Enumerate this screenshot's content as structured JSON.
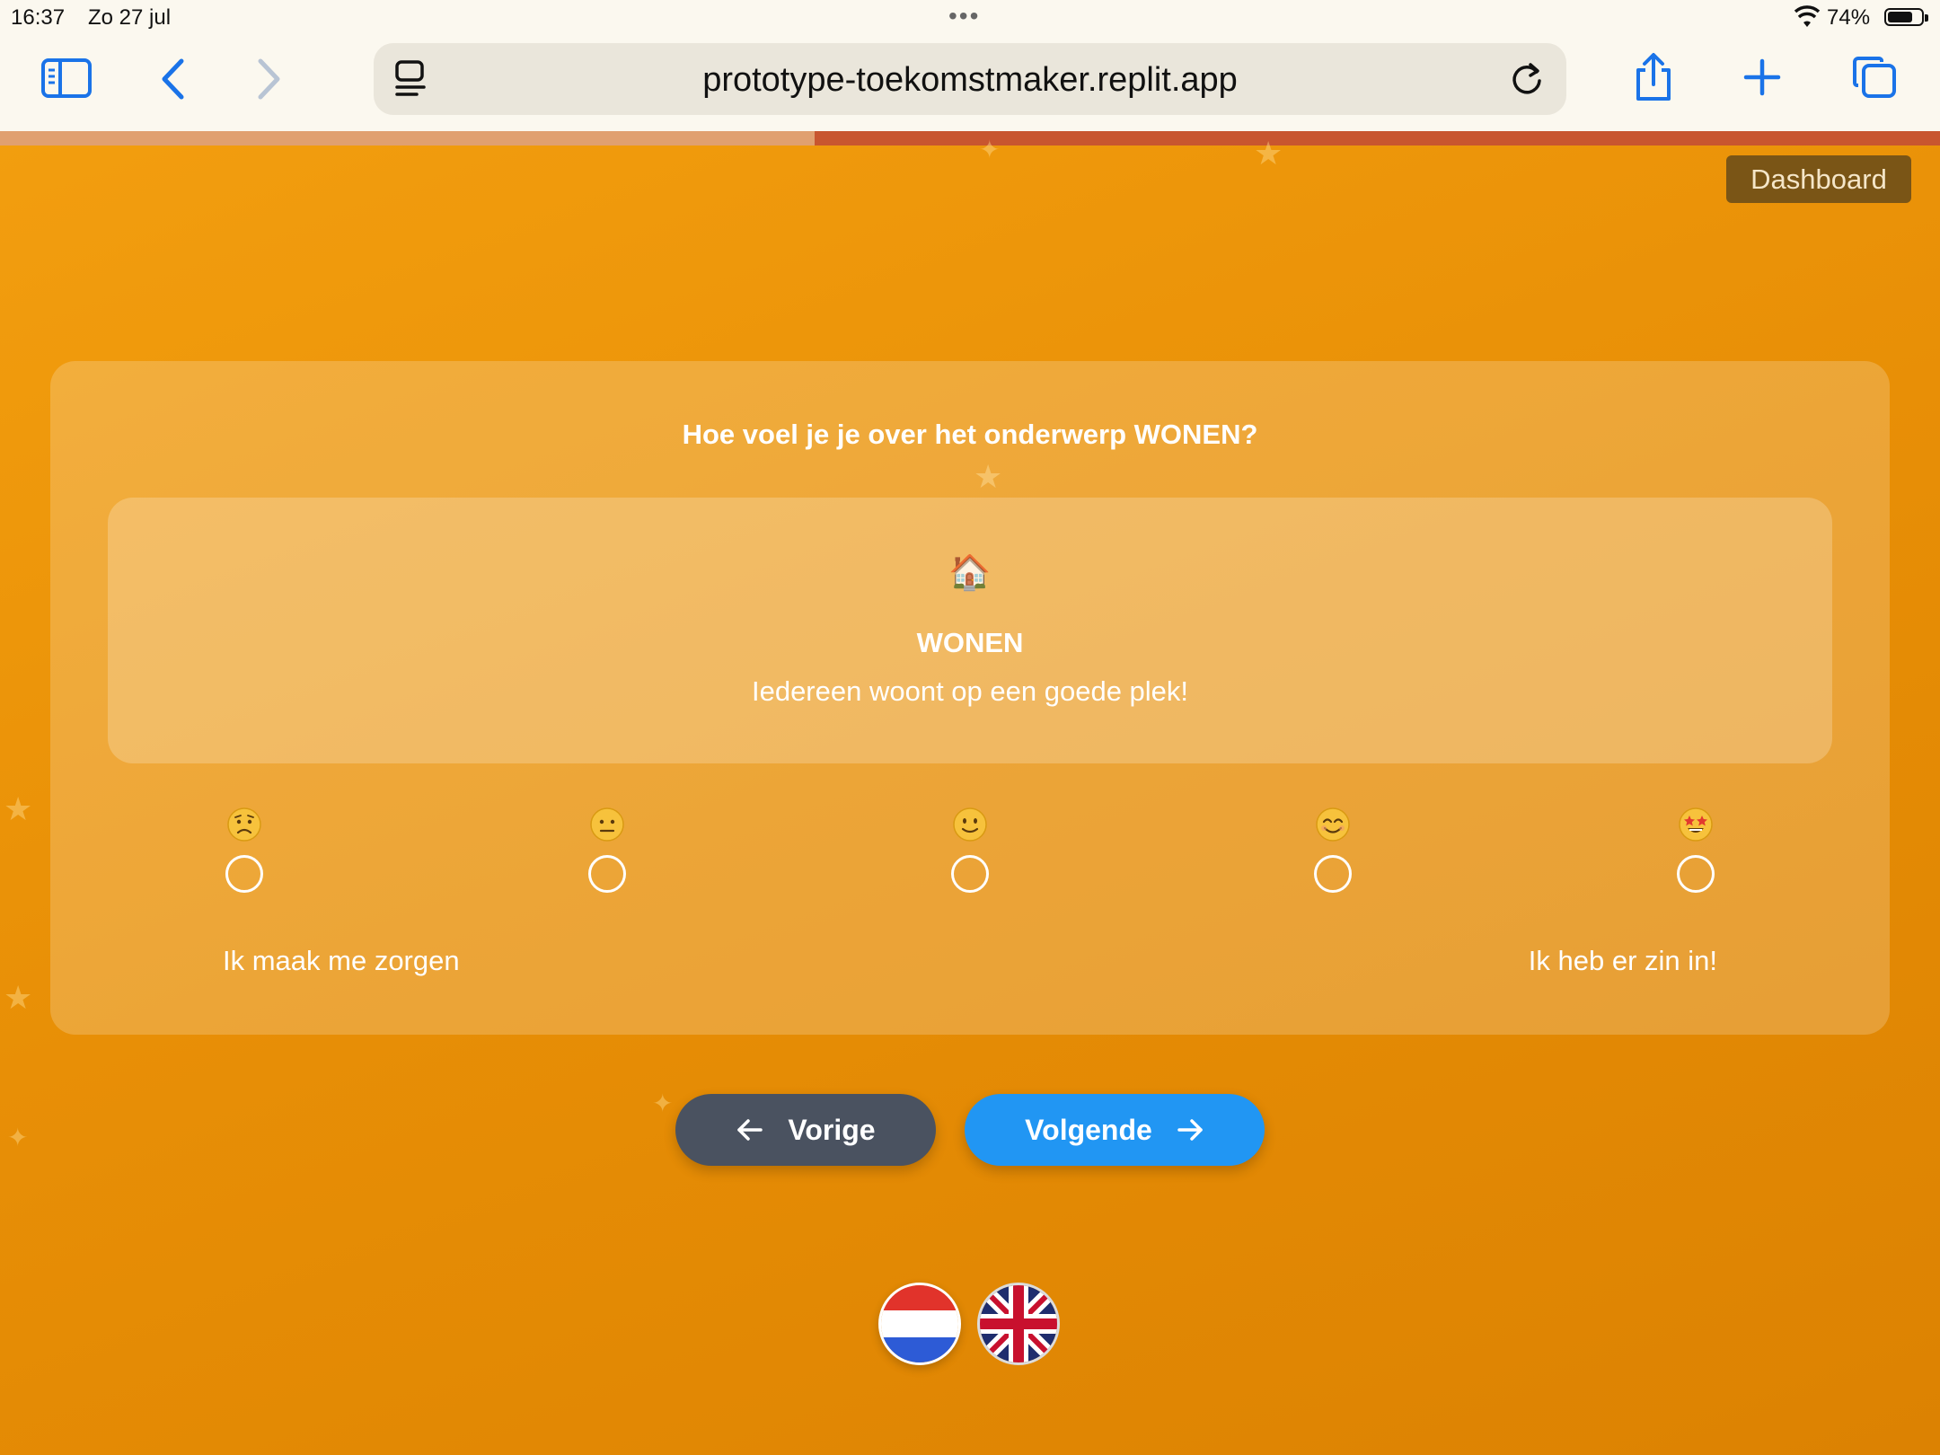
{
  "status_bar": {
    "time": "16:37",
    "date": "Zo 27 jul",
    "multitask_dots": "•••",
    "battery_percent": "74%",
    "battery_level": 0.74
  },
  "browser": {
    "url": "prototype-toekomstmaker.replit.app",
    "icons": [
      "sidebar-icon",
      "back-icon",
      "forward-icon",
      "reader-icon",
      "reload-icon",
      "share-icon",
      "new-tab-icon",
      "tabs-icon"
    ],
    "accent_color": "#1a73e8"
  },
  "page": {
    "progress": 0.42,
    "dashboard_label": "Dashboard",
    "question": "Hoe voel je je over het onderwerp WONEN?",
    "topic": {
      "emoji": "🏠",
      "title": "WONEN",
      "description": "Iedereen woont op een goede plek!"
    },
    "scale": {
      "options": [
        {
          "emoji": "😟",
          "value": 1
        },
        {
          "emoji": "😐",
          "value": 2
        },
        {
          "emoji": "🙂",
          "value": 3
        },
        {
          "emoji": "😊",
          "value": 4
        },
        {
          "emoji": "🤩",
          "value": 5
        }
      ],
      "label_min": "Ik maak me zorgen",
      "label_max": "Ik heb er zin in!"
    },
    "prev_label": "Vorige",
    "next_label": "Volgende",
    "languages": [
      "nl",
      "en"
    ],
    "colors": {
      "background": "#ec940a",
      "prev_button": "#4a5260",
      "next_button": "#2196f3",
      "dashboard_button": "#7a5516"
    }
  }
}
